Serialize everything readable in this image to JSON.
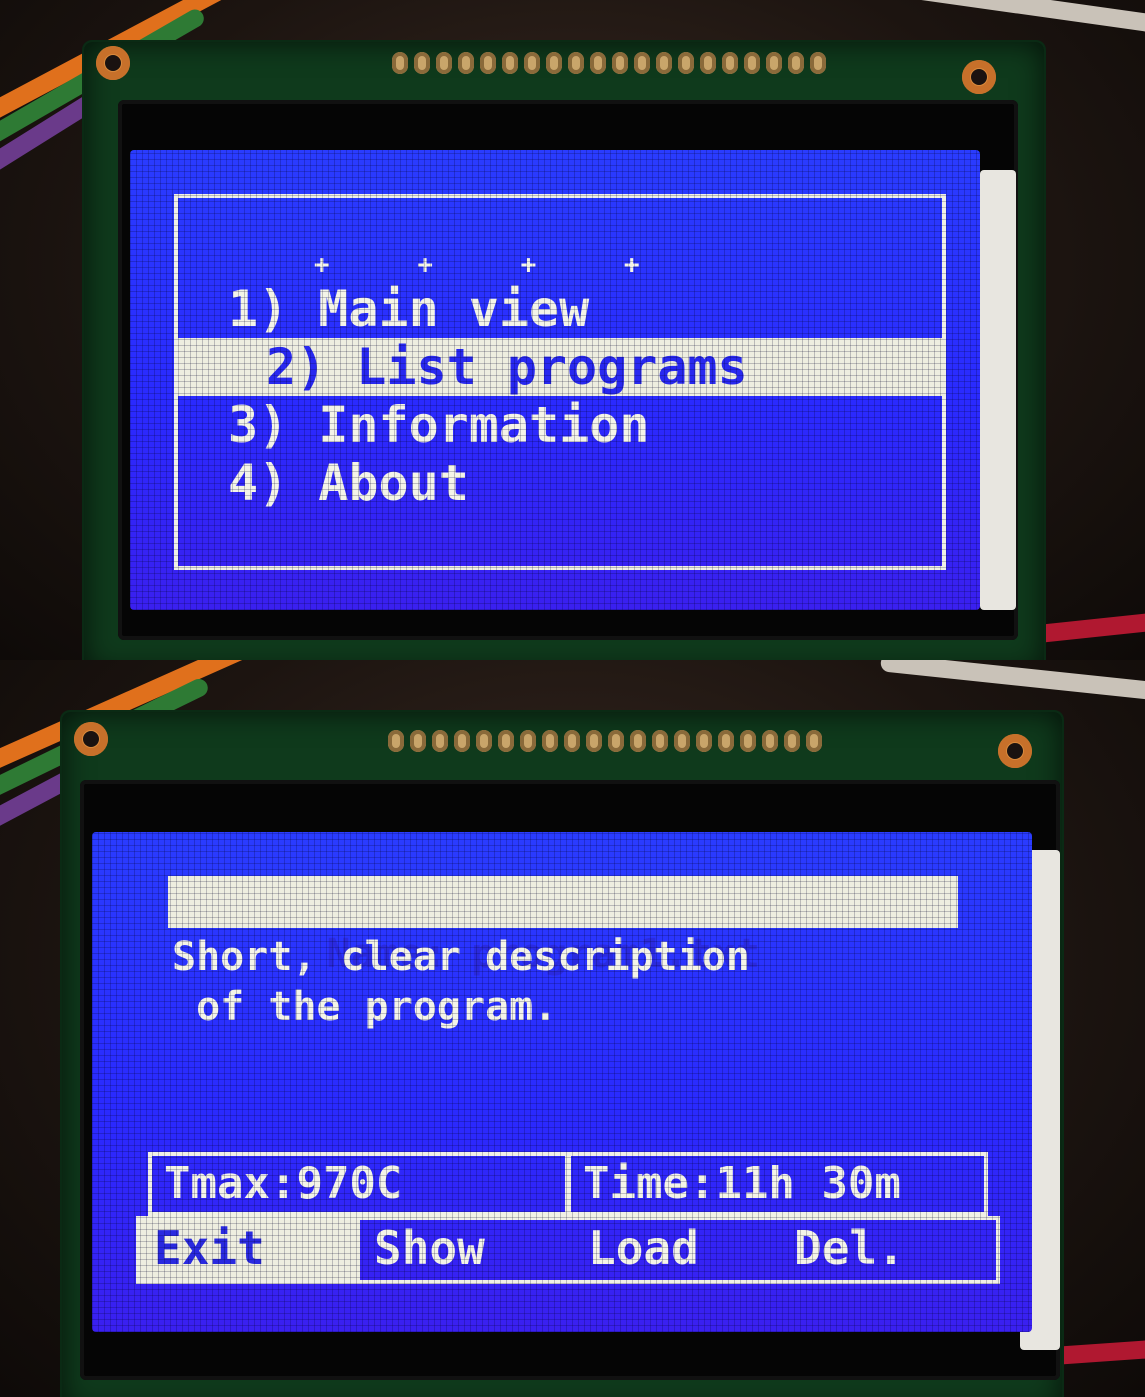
{
  "menu_screen": {
    "indicator": "+ + + +",
    "items": [
      {
        "label": "1) Main view",
        "selected": false
      },
      {
        "label": "2) List programs",
        "selected": true
      },
      {
        "label": "3) Information",
        "selected": false
      },
      {
        "label": "4) About",
        "selected": false
      }
    ]
  },
  "program_screen": {
    "name_label": "Name:",
    "name_value": "program1.txt",
    "description_line1": "Short, clear description",
    "description_line2": " of the program.",
    "tmax": "Tmax:970C",
    "time": "Time:11h 30m",
    "buttons": [
      {
        "label": "Exit",
        "active": true
      },
      {
        "label": "Show",
        "active": false
      },
      {
        "label": "Load",
        "active": false
      },
      {
        "label": "Del.",
        "active": false
      }
    ]
  },
  "colors": {
    "lcd_blue": "#2a30ff",
    "lcd_text": "#f4f4e8",
    "pcb_green": "#0f3a1c"
  }
}
